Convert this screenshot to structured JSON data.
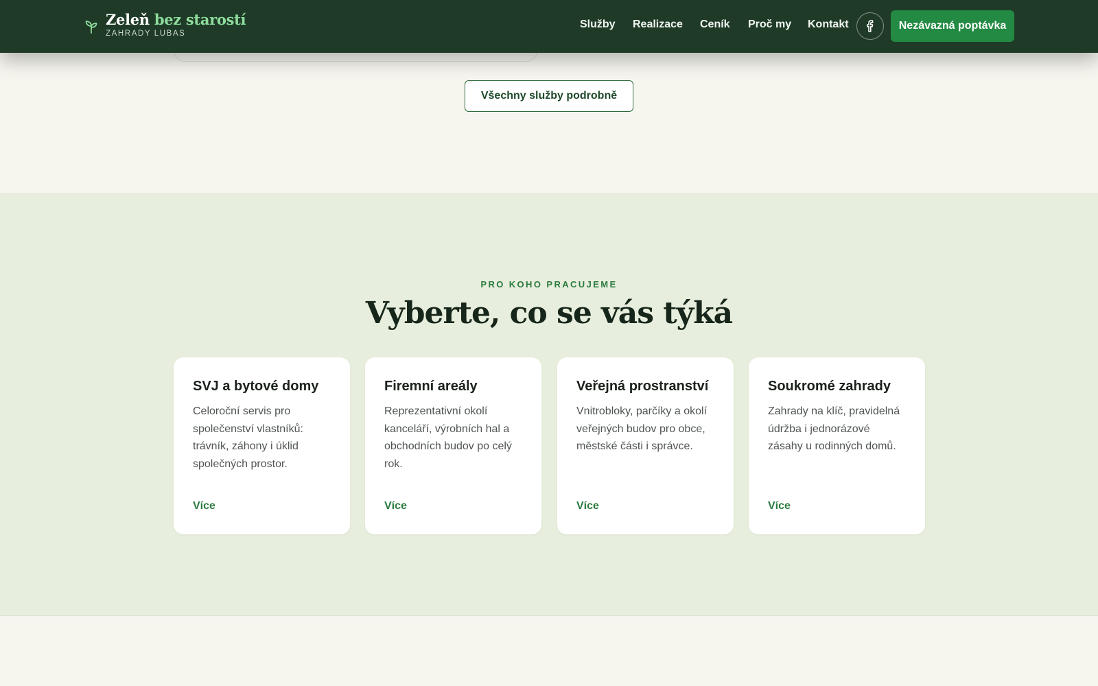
{
  "header": {
    "brand_title_main": "Zeleň",
    "brand_title_accent": "bez starostí",
    "brand_sub": "ZAHRADY LUBAS",
    "brand_icon": "sprout-icon",
    "nav": [
      "Služby",
      "Realizace",
      "Ceník",
      "Proč my",
      "Kontakt"
    ],
    "facebook_icon": "facebook-icon",
    "cta_label": "Nezávazná poptávka"
  },
  "services": {
    "all_services_label": "Všechny služby podrobně"
  },
  "audience": {
    "eyebrow": "PRO KOHO PRACUJEME",
    "title": "Vyberte, co se vás týká",
    "cards": [
      {
        "title": "SVJ a bytové domy",
        "text": "Celoroční servis pro společenství vlastníků: trávník, záhony i úklid společných prostor.",
        "link": "Více"
      },
      {
        "title": "Firemní areály",
        "text": "Reprezentativní okolí kanceláří, výrobních hal a obchodních budov po celý rok.",
        "link": "Více"
      },
      {
        "title": "Veřejná prostranství",
        "text": "Vnitrobloky, parčíky a okolí veřejných budov pro obce, městské části i správce.",
        "link": "Více"
      },
      {
        "title": "Soukromé zahrady",
        "text": "Zahrady na klíč, pravidelná údržba i jednorázové zásahy u rodinných domů.",
        "link": "Více"
      }
    ]
  },
  "colors": {
    "header_bg": "#1f3b28",
    "accent_green": "#238a43",
    "audience_bg": "#e8eedd",
    "page_bg": "#f6f5ee"
  }
}
